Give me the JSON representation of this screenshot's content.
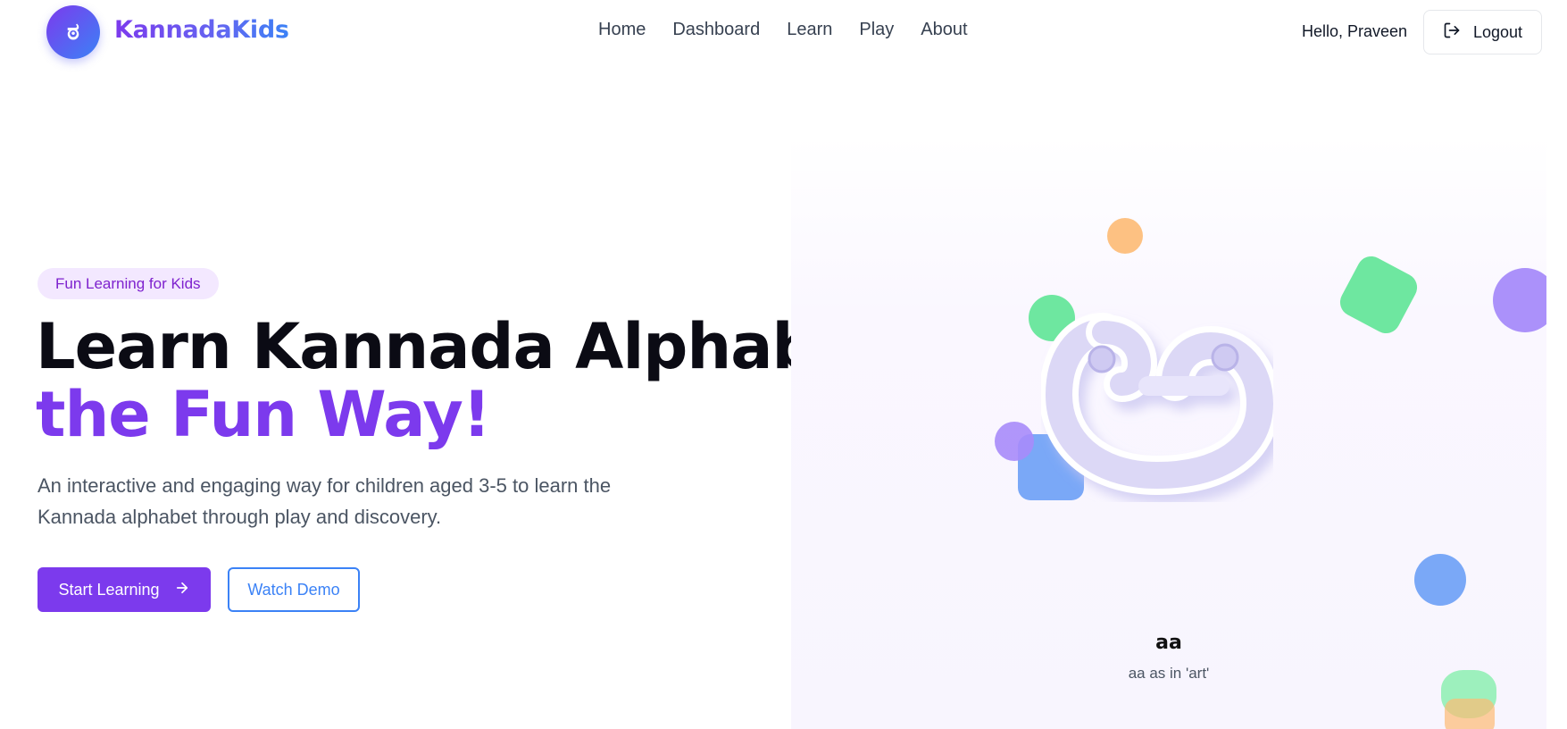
{
  "brand": {
    "logo_glyph": "ಠ",
    "name": "KannadaKids"
  },
  "nav": {
    "items": [
      "Home",
      "Dashboard",
      "Learn",
      "Play",
      "About"
    ]
  },
  "user": {
    "greeting": "Hello, Praveen",
    "logout_label": "Logout"
  },
  "hero": {
    "badge": "Fun Learning for Kids",
    "title_line1": "Learn Kannada Alphabet",
    "title_line2": "the Fun Way!",
    "description": "An interactive and engaging way for children aged 3-5 to learn the Kannada alphabet through play and discovery.",
    "primary_button": "Start Learning",
    "secondary_button": "Watch Demo"
  },
  "showcase": {
    "letter_glyph": "ಆ",
    "letter_name": "aa",
    "letter_hint": "aa as in 'art'"
  },
  "colors": {
    "primary": "#7c3aed",
    "accent_blue": "#3b82f6",
    "green": "#6ee7a0",
    "orange": "#fdba74",
    "purple_shape": "#a78bfa"
  },
  "icons": [
    "logout-icon",
    "arrow-right-icon"
  ]
}
